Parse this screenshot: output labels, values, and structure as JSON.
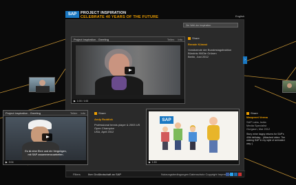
{
  "header": {
    "logo": "SAP",
    "title": "PROJECT INSPIRATION",
    "subtitle": "CELEBRATE 40 YEARS OF THE FUTURE",
    "language": "English"
  },
  "search": {
    "placeholder": "Die Welt der Inspiration"
  },
  "main_video": {
    "title": "Project Inspiration - Greeting",
    "actions": [
      "Teilen",
      "Info"
    ],
    "time": "1:00",
    "duration": "1:53"
  },
  "main_info": {
    "share_label": "Share",
    "name": "Renate Künast",
    "description": "Vorsitzende der Bundestagsfraktion Bündnis 90/Die Grünen",
    "location_date": "Berlin, Juni 2012"
  },
  "card_left": {
    "share_label": "Share",
    "name": "Andy Roddick",
    "description": "Professional tennis player & 2003 US Open Champion",
    "location_date": "USA, April 2012"
  },
  "card_right": {
    "share_label": "Share",
    "name": "Manpreet Verma",
    "lines": [
      "SAP Labs, India",
      "Media Specialist",
      "Gurgaon, Mai 2012",
      "Story mine happy returns for SAP's 40th birthday... (Attached video: The waking SAP in my style of animated way :)"
    ]
  },
  "video_left": {
    "title": "Project Inspiration - Greeting",
    "actions": [
      "Teilen",
      "Info"
    ],
    "caption_line1": "Es ist eine Ehre und ein Vergnügen,",
    "caption_line2": "mit SAP zusammenzuarbeiten.",
    "time": "0:04"
  },
  "video_cartoon": {
    "logo": "SAP",
    "time": "1:53"
  },
  "footer": {
    "label": "Filters",
    "partner": "Ihre Großbotschaft an SAP",
    "links": "Nutzungsbedingungen   Datenschutz   Copyright   Impressum"
  }
}
